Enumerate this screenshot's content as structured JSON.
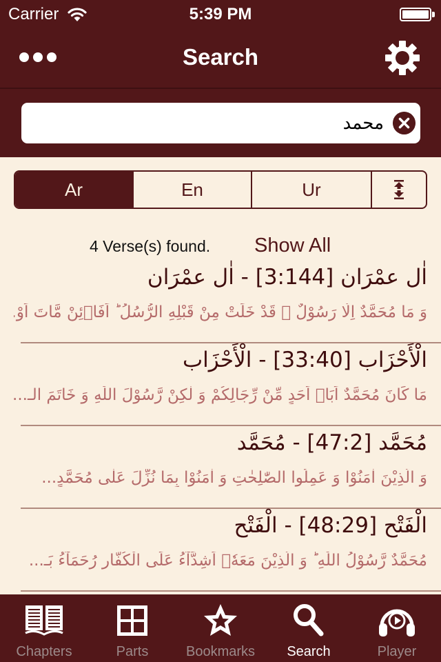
{
  "status_bar": {
    "carrier": "Carrier",
    "time": "5:39 PM",
    "icons": [
      "wifi-icon",
      "battery-icon"
    ]
  },
  "navbar": {
    "title": "Search",
    "left_icon": "more-icon",
    "right_icon": "gear-icon"
  },
  "search": {
    "value": "محمد",
    "clear_icon": "clear-icon"
  },
  "segments": [
    {
      "label": "Ar",
      "active": true
    },
    {
      "label": "En",
      "active": false
    },
    {
      "label": "Ur",
      "active": false
    },
    {
      "label": "",
      "icon": "expand-collapse-icon",
      "active": false
    }
  ],
  "results_info": {
    "count_text": "4 Verse(s) found.",
    "show_all_label": "Show All"
  },
  "results": [
    {
      "surah": "اٰل عمْرَان",
      "reference": "[3:144]",
      "surah_name": "اٰل عمْرَان",
      "heading": "اٰل عمْرَان  [3:144] - اٰل عمْرَان",
      "verse": "وَ مَا مُحَمَّدٌ اِلَّا رَسُوْلٌ ۚ قَدْ خَلَتْ مِنْ قَبْلِهِ الرُّسُلُ ؕ اَفَاۡئِنْ مَّاتَ اَوْ..."
    },
    {
      "surah": "الْأَحْزَاب",
      "reference": "[33:40]",
      "surah_name": "الْأَحْزَاب",
      "heading": "الْأَحْزَاب  [33:40] - الْأَحْزَاب",
      "verse": "مَا كَانَ مُحَمَّدٌ اَبَاۤ اَحَدٍ مِّنْ رِّجَالِكُمْ وَ لٰكِنْ رَّسُوْلَ اللّٰهِ وَ خَاتَمَ الـ..."
    },
    {
      "surah": "مُحَمَّد",
      "reference": "[47:2]",
      "surah_name": "مُحَمَّد",
      "heading": "مُحَمَّد  [47:2] - مُحَمَّد",
      "verse": "وَ الَّذِيْنَ اٰمَنُوْا وَ عَمِلُوا الصّٰلِحٰتِ وَ اٰمَنُوْا بِمَا نُزِّلَ عَلٰى مُحَمَّدٍ..."
    },
    {
      "surah": "الْفَتْح",
      "reference": "[48:29]",
      "surah_name": "الْفَتْح",
      "heading": "الْفَتْح  [48:29] - الْفَتْح",
      "verse": "مُحَمَّدٌ رَّسُوْلُ اللّٰهِ ؕ وَ الَّذِيْنَ مَعَهٗۤ اَشِدَّآءُ عَلَى الْكُفَّارِ رُحَمَآءُ بَـ..."
    }
  ],
  "tabbar": {
    "items": [
      {
        "label": "Chapters",
        "icon": "book-icon",
        "active": false
      },
      {
        "label": "Parts",
        "icon": "grid-icon",
        "active": false
      },
      {
        "label": "Bookmarks",
        "icon": "star-icon",
        "active": false
      },
      {
        "label": "Search",
        "icon": "search-icon",
        "active": true
      },
      {
        "label": "Player",
        "icon": "headphones-icon",
        "active": false
      }
    ]
  },
  "colors": {
    "primary": "#521719",
    "background": "#faf0e1",
    "verse_text": "#b46a6a",
    "heading_text": "#3f0d0e",
    "inactive_tab": "#9c8a8a"
  }
}
